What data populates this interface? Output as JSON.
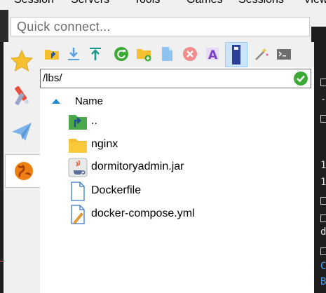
{
  "menubar": {
    "items": [
      "Session",
      "Servers",
      "Tools",
      "Games",
      "Sessions",
      "View"
    ]
  },
  "quick_connect": {
    "placeholder": "Quick connect..."
  },
  "sidebar": {
    "tabs": [
      "favorites-star-icon",
      "tools-icon",
      "send-icon",
      "sftp-globe-icon"
    ]
  },
  "toolbar": {
    "buttons": [
      "parent-directory-icon",
      "download-icon",
      "upload-icon",
      "refresh-icon",
      "new-folder-icon",
      "new-file-icon",
      "delete-icon",
      "rename-icon",
      "toggle-view-icon",
      "magic-wand-icon",
      "terminal-icon"
    ]
  },
  "path": {
    "value": "/lbs/"
  },
  "list_header": {
    "name": "Name"
  },
  "files": [
    {
      "name": "..",
      "icon": "parent-folder-icon"
    },
    {
      "name": "nginx",
      "icon": "folder-icon"
    },
    {
      "name": "dormitoryadmin.jar",
      "icon": "java-file-icon"
    },
    {
      "name": "Dockerfile",
      "icon": "file-icon"
    },
    {
      "name": "docker-compose.yml",
      "icon": "yml-file-icon"
    }
  ],
  "terminal": {
    "lines": [
      "1",
      "1",
      "d",
      "C",
      "B"
    ]
  },
  "colors": {
    "accent": "#1e8ad6",
    "ok": "#3aaa35",
    "folder": "#f5c030"
  }
}
